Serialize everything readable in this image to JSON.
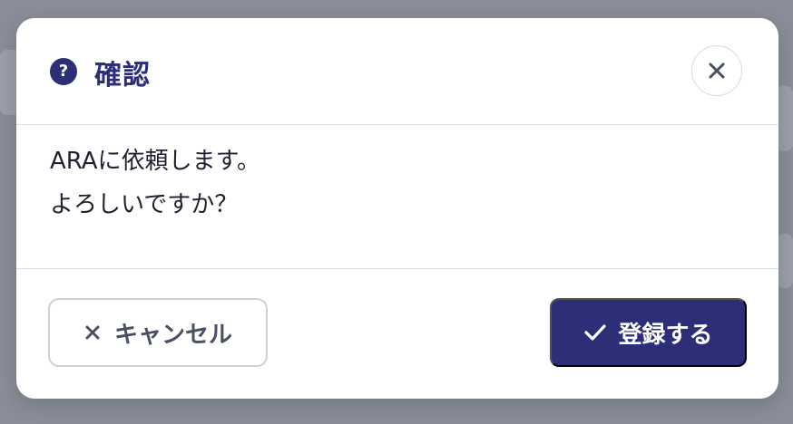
{
  "dialog": {
    "title": "確認",
    "help_icon_glyph": "?",
    "icons": [
      "question-circle-icon",
      "close-icon",
      "x-icon",
      "check-icon"
    ],
    "message_line1": "ARAに依頼します。",
    "message_line2": "よろしいですか？",
    "cancel_label": "キャンセル",
    "submit_label": "登録する"
  },
  "colors": {
    "accent": "#2c2f78",
    "overlay": "#8a8e99",
    "text": "#1e2230",
    "border": "#cbd0da"
  }
}
